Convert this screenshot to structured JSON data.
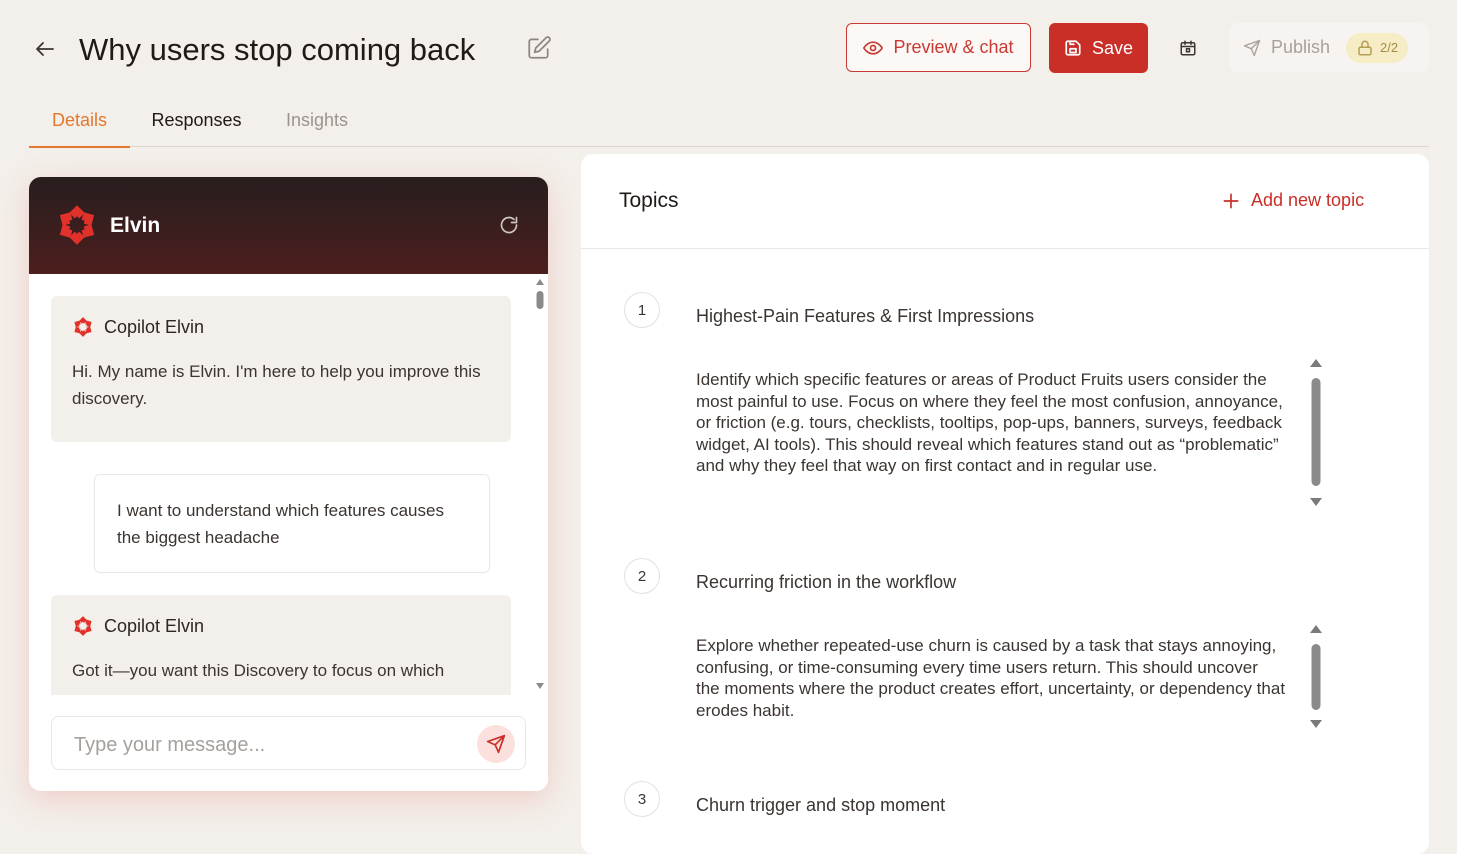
{
  "header": {
    "title": "Why users stop coming back",
    "preview_label": "Preview & chat",
    "save_label": "Save",
    "publish_label": "Publish",
    "publish_count": "2/2"
  },
  "tabs": [
    {
      "label": "Details"
    },
    {
      "label": "Responses"
    },
    {
      "label": "Insights"
    }
  ],
  "chat": {
    "name": "Elvin",
    "messages": [
      {
        "sender": "Copilot Elvin",
        "text": "Hi. My name is Elvin. I'm here to help you improve this discovery."
      },
      {
        "text": "I want to understand which features causes the biggest headache"
      },
      {
        "sender": "Copilot Elvin",
        "text": "Got it—you want this Discovery to focus on which"
      }
    ],
    "input_placeholder": "Type your message..."
  },
  "topics": {
    "title": "Topics",
    "add_label": "Add new topic",
    "items": [
      {
        "number": "1",
        "title": "Highest-Pain Features & First Impressions",
        "description": "Identify which specific features or areas of Product Fruits users consider the most painful to use. Focus on where they feel the most confusion, annoyance, or friction (e.g. tours, checklists, tooltips, pop-ups, banners, surveys, feedback widget, AI tools). This should reveal which features stand out as “problematic” and why they feel that way on first contact and in regular use."
      },
      {
        "number": "2",
        "title": "Recurring friction in the workflow",
        "description": "Explore whether repeated-use churn is caused by a task that stays annoying, confusing, or time-consuming every time users return. This should uncover the moments where the product creates effort, uncertainty, or dependency that erodes habit."
      },
      {
        "number": "3",
        "title": "Churn trigger and stop moment",
        "description": ""
      }
    ]
  },
  "colors": {
    "accent": "#c92e27",
    "tab_active": "#e3782f",
    "background": "#f3efea"
  }
}
